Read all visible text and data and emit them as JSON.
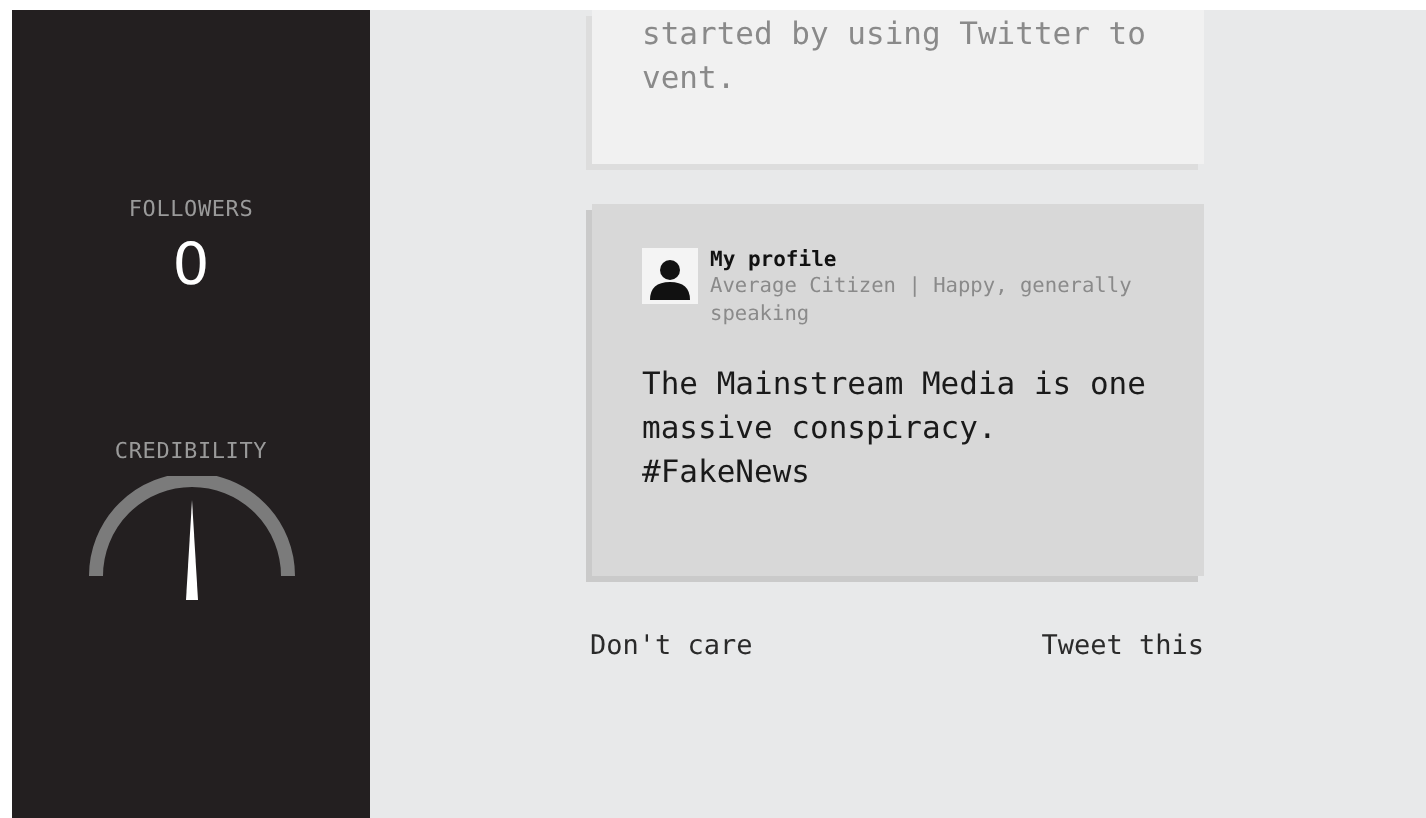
{
  "sidebar": {
    "followers": {
      "label": "FOLLOWERS",
      "value": "0"
    },
    "credibility": {
      "label": "CREDIBILITY",
      "level": 0.5
    }
  },
  "previous_tweet": {
    "text_lines": [
      "started by using Twitter to",
      "vent."
    ]
  },
  "tweet": {
    "author": "My profile",
    "bio": "Average Citizen | Happy, generally speaking",
    "text": "The Mainstream Media is one massive conspiracy. #FakeNews"
  },
  "actions": [
    {
      "label": "Don't care"
    },
    {
      "label": "Tweet this"
    }
  ]
}
